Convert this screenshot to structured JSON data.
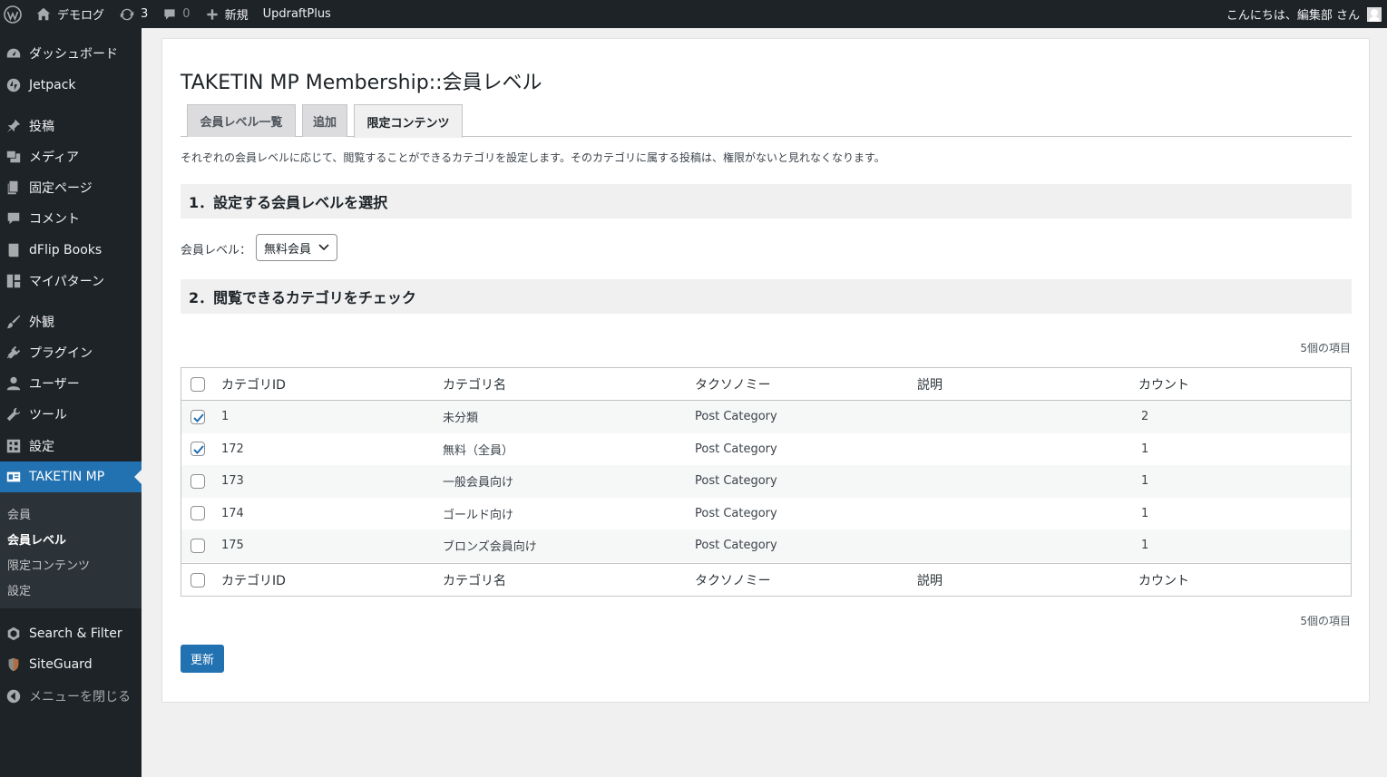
{
  "adminbar": {
    "site_name": "デモログ",
    "updates_count": "3",
    "comments_count": "0",
    "new_label": "新規",
    "plugin_link": "UpdraftPlus",
    "greeting": "こんにちは、編集部 さん"
  },
  "sidebar": {
    "items": [
      {
        "label": "ダッシュボード",
        "icon": "dashboard-icon"
      },
      {
        "label": "Jetpack",
        "icon": "jetpack-icon"
      },
      {
        "label": "投稿",
        "icon": "pin-icon"
      },
      {
        "label": "メディア",
        "icon": "media-icon"
      },
      {
        "label": "固定ページ",
        "icon": "page-icon"
      },
      {
        "label": "コメント",
        "icon": "comment-icon"
      },
      {
        "label": "dFlip Books",
        "icon": "book-icon"
      },
      {
        "label": "マイパターン",
        "icon": "pattern-icon"
      },
      {
        "label": "外観",
        "icon": "brush-icon"
      },
      {
        "label": "プラグイン",
        "icon": "plugin-icon"
      },
      {
        "label": "ユーザー",
        "icon": "user-icon"
      },
      {
        "label": "ツール",
        "icon": "wrench-icon"
      },
      {
        "label": "設定",
        "icon": "settings-icon"
      },
      {
        "label": "TAKETIN MP",
        "icon": "id-card-icon"
      },
      {
        "label": "Search & Filter",
        "icon": "filter-icon"
      },
      {
        "label": "SiteGuard",
        "icon": "guard-icon"
      },
      {
        "label": "メニューを閉じる",
        "icon": "collapse-icon"
      }
    ],
    "submenu": [
      "会員",
      "会員レベル",
      "限定コンテンツ",
      "設定"
    ]
  },
  "page": {
    "title": "TAKETIN MP Membership::会員レベル",
    "tabs": [
      "会員レベル一覧",
      "追加",
      "限定コンテンツ"
    ],
    "active_tab": "限定コンテンツ",
    "description": "それぞれの会員レベルに応じて、閲覧することができるカテゴリを設定します。そのカテゴリに属する投稿は、権限がないと見れなくなります。",
    "section1": "1．設定する会員レベルを選択",
    "level_label": "会員レベル：",
    "level_value": "無料会員",
    "section2": "2．閲覧できるカテゴリをチェック",
    "items_count": "5個の項目",
    "update_button": "更新"
  },
  "table": {
    "columns": [
      "カテゴリID",
      "カテゴリ名",
      "タクソノミー",
      "説明",
      "カウント"
    ],
    "rows": [
      {
        "checked": true,
        "id": "1",
        "name": "未分類",
        "taxonomy": "Post Category",
        "description": "",
        "count": "2"
      },
      {
        "checked": true,
        "id": "172",
        "name": "無料（全員）",
        "taxonomy": "Post Category",
        "description": "",
        "count": "1"
      },
      {
        "checked": false,
        "id": "173",
        "name": "一般会員向け",
        "taxonomy": "Post Category",
        "description": "",
        "count": "1"
      },
      {
        "checked": false,
        "id": "174",
        "name": "ゴールド向け",
        "taxonomy": "Post Category",
        "description": "",
        "count": "1"
      },
      {
        "checked": false,
        "id": "175",
        "name": "ブロンズ会員向け",
        "taxonomy": "Post Category",
        "description": "",
        "count": "1"
      }
    ]
  },
  "colors": {
    "adminbar_bg": "#1d2327",
    "accent": "#2271b1",
    "page_bg": "#f0f0f1"
  }
}
